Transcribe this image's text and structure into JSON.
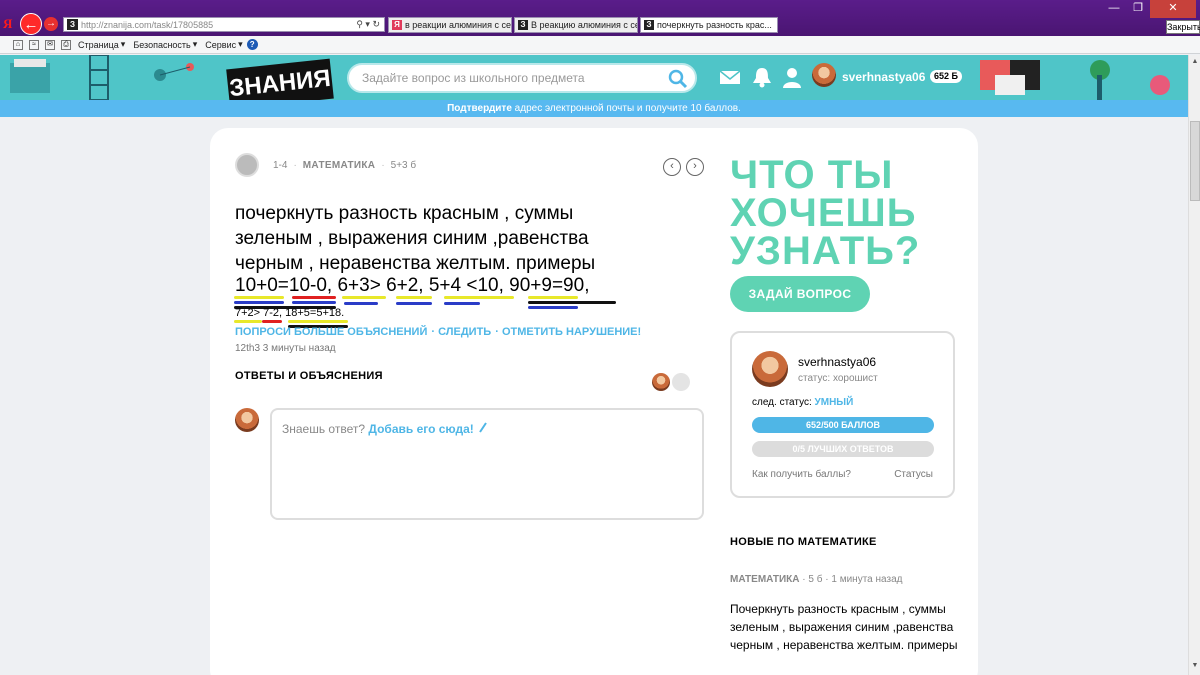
{
  "browser": {
    "address": "http://znanija.com/task/17805885",
    "tabs": [
      {
        "label": "в реакции алюминия с серно...",
        "fav": "Я"
      },
      {
        "label": "В реакцию алюминия с серн...",
        "fav": "З"
      },
      {
        "label": "почеркнуть разность крас...",
        "fav": "З",
        "close": "✕"
      }
    ],
    "close_tooltip": "Закрыть",
    "menu": {
      "page": "Страница",
      "security": "Безопасность",
      "service": "Сервис"
    }
  },
  "header": {
    "logo": "ЗНАНИЯ",
    "search_placeholder": "Задайте вопрос из школьного предмета",
    "username": "sverhnastya06",
    "points": "652 Б"
  },
  "banner": {
    "bold": "Подтвердите",
    "text": " адрес электронной почты и получите 10 баллов."
  },
  "question": {
    "grade": "1-4",
    "subject": "МАТЕМАТИКА",
    "points": "5+3 б",
    "text": "почеркнуть разность красным , суммы зеленым , выражения синим ,равенства черным , неравенства желтым. примеры",
    "examples_line1": "10+0=10-0, 6+3> 6+2, 5+4 <10, 90+9=90,",
    "examples_line2": "7+2> 7-2, 18+5=5+18.",
    "actions": {
      "ask_more": "ПОПРОСИ БОЛЬШЕ ОБЪЯСНЕНИЙ",
      "follow": "СЛЕДИТЬ",
      "report": "ОТМЕТИТЬ НАРУШЕНИЕ!"
    },
    "asked_by": "12th3 3 минуты назад"
  },
  "answers": {
    "title": "ОТВЕТЫ И ОБЪЯСНЕНИЯ",
    "prompt": "Знаешь ответ? ",
    "add_link": "Добавь его сюда!"
  },
  "sidebar": {
    "big_question": "ЧТО ТЫ ХОЧЕШЬ УЗНАТЬ?",
    "ask_button": "ЗАДАЙ ВОПРОС",
    "profile": {
      "name": "sverhnastya06",
      "status": "статус: хорошист",
      "next_label": "след. статус: ",
      "next_rank": "УМНЫЙ",
      "points_bar": "652/500 БАЛЛОВ",
      "best_bar": "0/5 ЛУЧШИХ ОТВЕТОВ",
      "how_to": "Как получить баллы?",
      "statuses": "Статусы"
    },
    "new_title": "НОВЫЕ ПО МАТЕМАТИКЕ",
    "new_item": {
      "subject": "МАТЕМАТИКА",
      "points": "5 б",
      "time": "1 минута назад",
      "text": "Почеркнуть разность красным , суммы зеленым , выражения синим ,равенства черным , неравенства желтым. примеры"
    }
  }
}
